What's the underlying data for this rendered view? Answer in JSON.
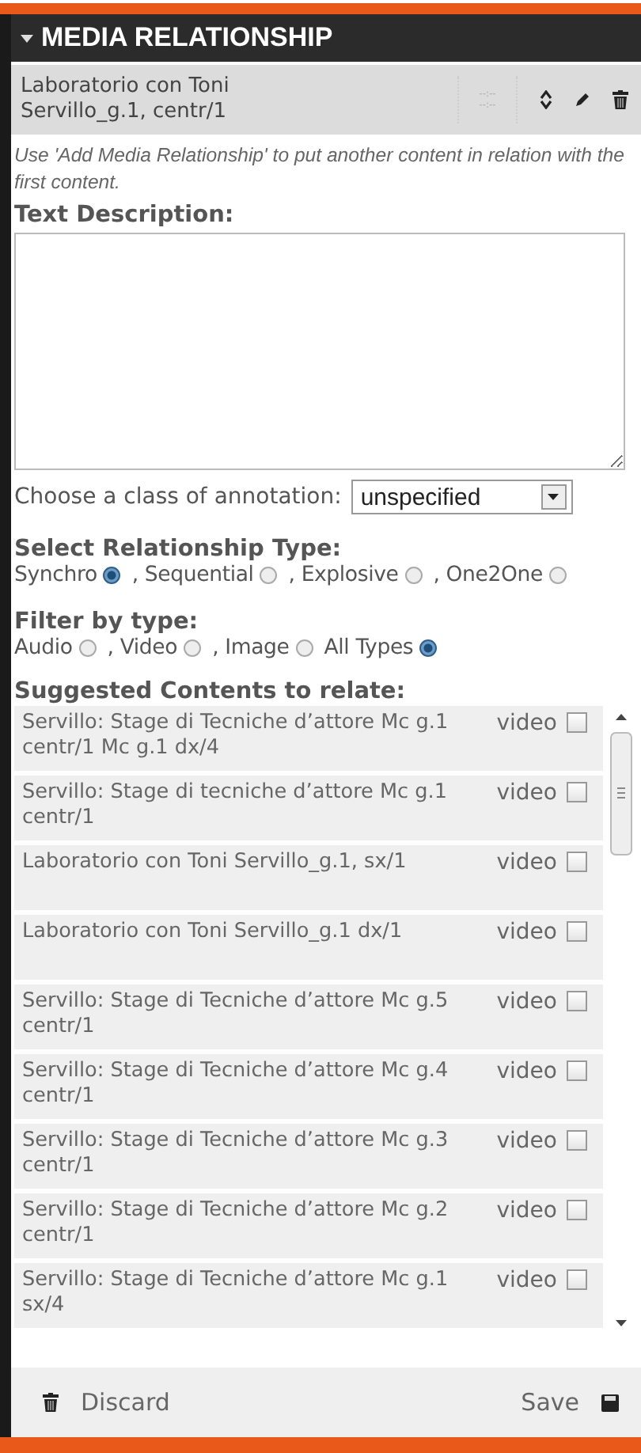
{
  "panel": {
    "title": "MEDIA RELATIONSHIP",
    "expanded": true
  },
  "current_item": {
    "title": "Laboratorio con Toni Servillo_g.1, centr/1",
    "time_start": "--:--",
    "time_end": "--:--"
  },
  "hint": "Use 'Add Media Relationship' to put another content in relation with the first content.",
  "text_description": {
    "label": "Text Description:"
  },
  "annotation_class": {
    "label": "Choose a class of annotation:",
    "value": "unspecified"
  },
  "relationship_type": {
    "label": "Select Relationship Type:",
    "options": [
      {
        "label": "Synchro",
        "selected": true,
        "separator": ","
      },
      {
        "label": "Sequential",
        "selected": false,
        "separator": ","
      },
      {
        "label": "Explosive",
        "selected": false,
        "separator": ","
      },
      {
        "label": "One2One",
        "selected": false
      }
    ]
  },
  "filter_by_type": {
    "label": "Filter by type:",
    "options": [
      {
        "label": "Audio",
        "selected": false,
        "separator": ","
      },
      {
        "label": "Video",
        "selected": false,
        "separator": ","
      },
      {
        "label": "Image",
        "selected": false
      },
      {
        "label": "All Types",
        "selected": true
      }
    ]
  },
  "suggested": {
    "label": "Suggested Contents to relate:",
    "rows": [
      {
        "title": "Servillo: Stage di Tecniche d’attore Mc g.1 centr/1 Mc g.1 dx/4",
        "type": "video",
        "checked": false
      },
      {
        "title": "Servillo: Stage di tecniche d’attore Mc g.1 centr/1",
        "type": "video",
        "checked": false
      },
      {
        "title": "Laboratorio con Toni Servillo_g.1, sx/1",
        "type": "video",
        "checked": false
      },
      {
        "title": "Laboratorio con Toni Servillo_g.1 dx/1",
        "type": "video",
        "checked": false
      },
      {
        "title": "Servillo: Stage di Tecniche d’attore Mc g.5 centr/1",
        "type": "video",
        "checked": false
      },
      {
        "title": "Servillo: Stage di Tecniche d’attore Mc g.4 centr/1",
        "type": "video",
        "checked": false
      },
      {
        "title": "Servillo: Stage di Tecniche d’attore Mc g.3 centr/1",
        "type": "video",
        "checked": false
      },
      {
        "title": "Servillo: Stage di Tecniche d’attore Mc g.2 centr/1",
        "type": "video",
        "checked": false
      },
      {
        "title": "Servillo: Stage di Tecniche d’attore Mc g.1 sx/4",
        "type": "video",
        "checked": false
      }
    ]
  },
  "footer": {
    "discard": "Discard",
    "save": "Save"
  }
}
